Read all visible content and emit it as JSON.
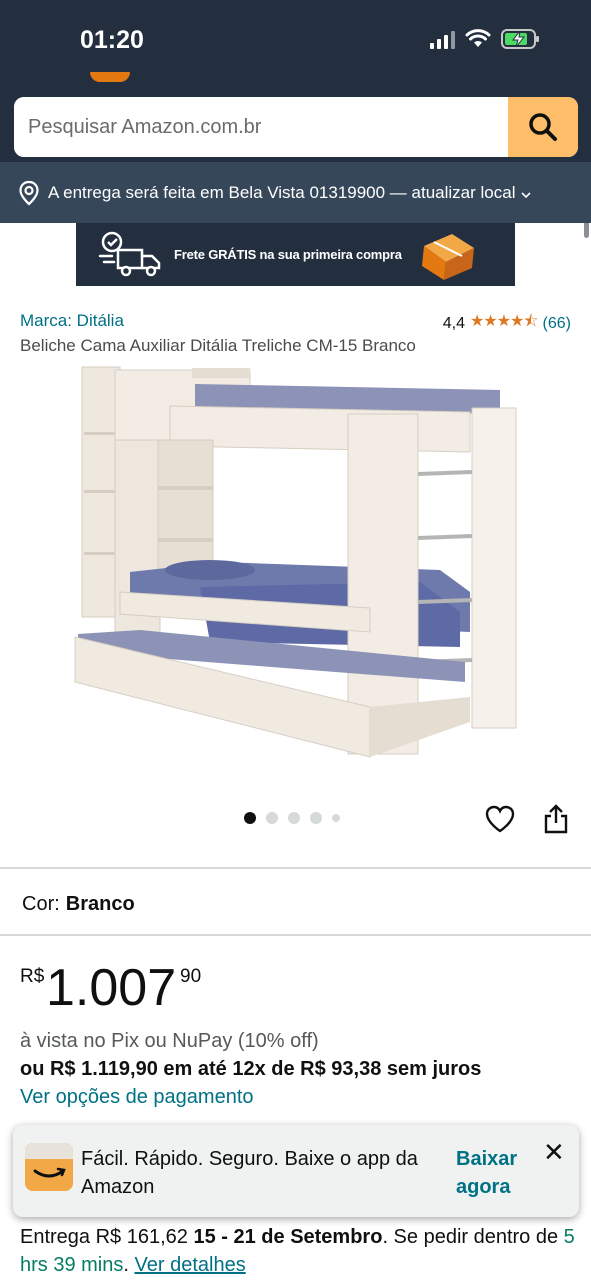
{
  "status_bar": {
    "time": "01:20"
  },
  "search": {
    "placeholder": "Pesquisar Amazon.com.br"
  },
  "delivery": {
    "text": "A entrega será feita em Bela Vista 01319900 — atualizar local"
  },
  "promo": {
    "text": "Frete GRÁTIS na sua primeira compra"
  },
  "product": {
    "brand": "Marca: Ditália",
    "rating_value": "4,4",
    "rating_stars": "★★★★⯪",
    "rating_count": "(66)",
    "title": "Beliche Cama Auxiliar Ditália Treliche CM-15 Branco"
  },
  "carousel": {
    "total": 5,
    "active": 0
  },
  "variation": {
    "label": "Cor:",
    "value": "Branco"
  },
  "price": {
    "currency": "R$",
    "whole": "1.007",
    "cents": "90",
    "pix_note": "à vista no Pix ou NuPay (10% off)",
    "installments": "ou R$ 1.119,90 em até 12x de R$ 93,38 sem juros",
    "payment_options_link": "Ver opções de pagamento"
  },
  "app_banner": {
    "text": "Fácil. Rápido. Seguro. Baixe o app da Amazon",
    "cta": "Baixar agora",
    "close": "✕"
  },
  "delivery_info": {
    "prefix": "Entrega R$ 161,62 ",
    "dates": "15 - 21 de Setembro",
    "middle": ". Se pedir dentro de ",
    "countdown": "5 hrs 39 mins",
    "sep": ". ",
    "details_link": "Ver detalhes"
  },
  "colors": {
    "header": "#232f3e",
    "delivery_bar": "#37475a",
    "search_button": "#febd69",
    "link": "#007185",
    "star": "#de7921"
  }
}
